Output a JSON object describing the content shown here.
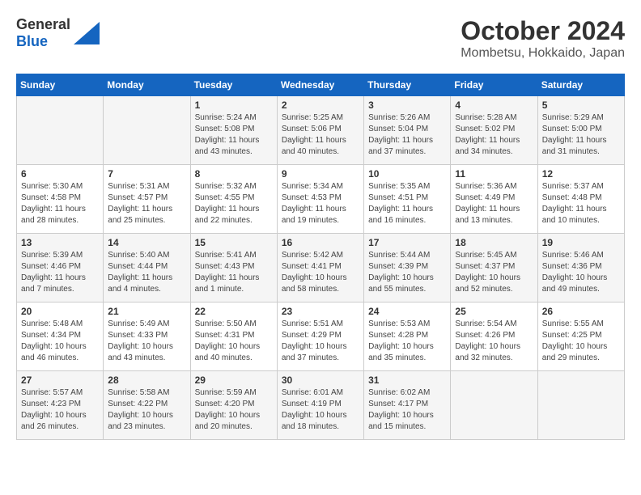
{
  "header": {
    "logo_general": "General",
    "logo_blue": "Blue",
    "title": "October 2024",
    "location": "Mombetsu, Hokkaido, Japan"
  },
  "days_of_week": [
    "Sunday",
    "Monday",
    "Tuesday",
    "Wednesday",
    "Thursday",
    "Friday",
    "Saturday"
  ],
  "weeks": [
    [
      {
        "day": "",
        "info": ""
      },
      {
        "day": "",
        "info": ""
      },
      {
        "day": "1",
        "info": "Sunrise: 5:24 AM\nSunset: 5:08 PM\nDaylight: 11 hours\nand 43 minutes."
      },
      {
        "day": "2",
        "info": "Sunrise: 5:25 AM\nSunset: 5:06 PM\nDaylight: 11 hours\nand 40 minutes."
      },
      {
        "day": "3",
        "info": "Sunrise: 5:26 AM\nSunset: 5:04 PM\nDaylight: 11 hours\nand 37 minutes."
      },
      {
        "day": "4",
        "info": "Sunrise: 5:28 AM\nSunset: 5:02 PM\nDaylight: 11 hours\nand 34 minutes."
      },
      {
        "day": "5",
        "info": "Sunrise: 5:29 AM\nSunset: 5:00 PM\nDaylight: 11 hours\nand 31 minutes."
      }
    ],
    [
      {
        "day": "6",
        "info": "Sunrise: 5:30 AM\nSunset: 4:58 PM\nDaylight: 11 hours\nand 28 minutes."
      },
      {
        "day": "7",
        "info": "Sunrise: 5:31 AM\nSunset: 4:57 PM\nDaylight: 11 hours\nand 25 minutes."
      },
      {
        "day": "8",
        "info": "Sunrise: 5:32 AM\nSunset: 4:55 PM\nDaylight: 11 hours\nand 22 minutes."
      },
      {
        "day": "9",
        "info": "Sunrise: 5:34 AM\nSunset: 4:53 PM\nDaylight: 11 hours\nand 19 minutes."
      },
      {
        "day": "10",
        "info": "Sunrise: 5:35 AM\nSunset: 4:51 PM\nDaylight: 11 hours\nand 16 minutes."
      },
      {
        "day": "11",
        "info": "Sunrise: 5:36 AM\nSunset: 4:49 PM\nDaylight: 11 hours\nand 13 minutes."
      },
      {
        "day": "12",
        "info": "Sunrise: 5:37 AM\nSunset: 4:48 PM\nDaylight: 11 hours\nand 10 minutes."
      }
    ],
    [
      {
        "day": "13",
        "info": "Sunrise: 5:39 AM\nSunset: 4:46 PM\nDaylight: 11 hours\nand 7 minutes."
      },
      {
        "day": "14",
        "info": "Sunrise: 5:40 AM\nSunset: 4:44 PM\nDaylight: 11 hours\nand 4 minutes."
      },
      {
        "day": "15",
        "info": "Sunrise: 5:41 AM\nSunset: 4:43 PM\nDaylight: 11 hours\nand 1 minute."
      },
      {
        "day": "16",
        "info": "Sunrise: 5:42 AM\nSunset: 4:41 PM\nDaylight: 10 hours\nand 58 minutes."
      },
      {
        "day": "17",
        "info": "Sunrise: 5:44 AM\nSunset: 4:39 PM\nDaylight: 10 hours\nand 55 minutes."
      },
      {
        "day": "18",
        "info": "Sunrise: 5:45 AM\nSunset: 4:37 PM\nDaylight: 10 hours\nand 52 minutes."
      },
      {
        "day": "19",
        "info": "Sunrise: 5:46 AM\nSunset: 4:36 PM\nDaylight: 10 hours\nand 49 minutes."
      }
    ],
    [
      {
        "day": "20",
        "info": "Sunrise: 5:48 AM\nSunset: 4:34 PM\nDaylight: 10 hours\nand 46 minutes."
      },
      {
        "day": "21",
        "info": "Sunrise: 5:49 AM\nSunset: 4:33 PM\nDaylight: 10 hours\nand 43 minutes."
      },
      {
        "day": "22",
        "info": "Sunrise: 5:50 AM\nSunset: 4:31 PM\nDaylight: 10 hours\nand 40 minutes."
      },
      {
        "day": "23",
        "info": "Sunrise: 5:51 AM\nSunset: 4:29 PM\nDaylight: 10 hours\nand 37 minutes."
      },
      {
        "day": "24",
        "info": "Sunrise: 5:53 AM\nSunset: 4:28 PM\nDaylight: 10 hours\nand 35 minutes."
      },
      {
        "day": "25",
        "info": "Sunrise: 5:54 AM\nSunset: 4:26 PM\nDaylight: 10 hours\nand 32 minutes."
      },
      {
        "day": "26",
        "info": "Sunrise: 5:55 AM\nSunset: 4:25 PM\nDaylight: 10 hours\nand 29 minutes."
      }
    ],
    [
      {
        "day": "27",
        "info": "Sunrise: 5:57 AM\nSunset: 4:23 PM\nDaylight: 10 hours\nand 26 minutes."
      },
      {
        "day": "28",
        "info": "Sunrise: 5:58 AM\nSunset: 4:22 PM\nDaylight: 10 hours\nand 23 minutes."
      },
      {
        "day": "29",
        "info": "Sunrise: 5:59 AM\nSunset: 4:20 PM\nDaylight: 10 hours\nand 20 minutes."
      },
      {
        "day": "30",
        "info": "Sunrise: 6:01 AM\nSunset: 4:19 PM\nDaylight: 10 hours\nand 18 minutes."
      },
      {
        "day": "31",
        "info": "Sunrise: 6:02 AM\nSunset: 4:17 PM\nDaylight: 10 hours\nand 15 minutes."
      },
      {
        "day": "",
        "info": ""
      },
      {
        "day": "",
        "info": ""
      }
    ]
  ]
}
